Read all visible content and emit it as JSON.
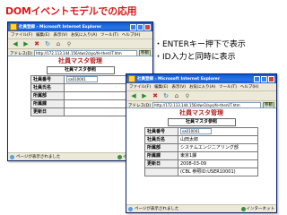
{
  "slide": {
    "title": "DOMイベントモデルでの応用",
    "bullets": [
      "・ENTERキー押下で表示",
      "・ID入力と同時に表示"
    ]
  },
  "browser": {
    "title": "社員登録 - Microsoft Internet Explorer",
    "menu": [
      "ファイル(F)",
      "編集(E)",
      "表示(V)",
      "お気に入り(A)",
      "ツール(T)",
      "ヘルプ(H)"
    ],
    "address_label": "アドレス(D)",
    "address_value": "http://172.113.144.156/dwr2/ayo/fe-therUT.htm",
    "go_label": "移動",
    "status_text": "ページが表示されました",
    "zone_text": "インターネット"
  },
  "page": {
    "title": "社員マスタ管理",
    "subtitle": "社員マスタ参照",
    "fields": [
      {
        "label": "社員番号"
      },
      {
        "label": "社員氏名"
      },
      {
        "label": "所属部"
      },
      {
        "label": "所属課"
      },
      {
        "label": "更新日"
      }
    ]
  },
  "window1": {
    "id_value": "sa010001"
  },
  "window2": {
    "id_value": "sa010001",
    "name_value": "山田太郎",
    "dept_value": "システムエンジニアリング部",
    "section_value": "東京1課",
    "updated_value": "2008-03-09",
    "updated_extra": "(CBL 参照ID:USER10001)"
  }
}
